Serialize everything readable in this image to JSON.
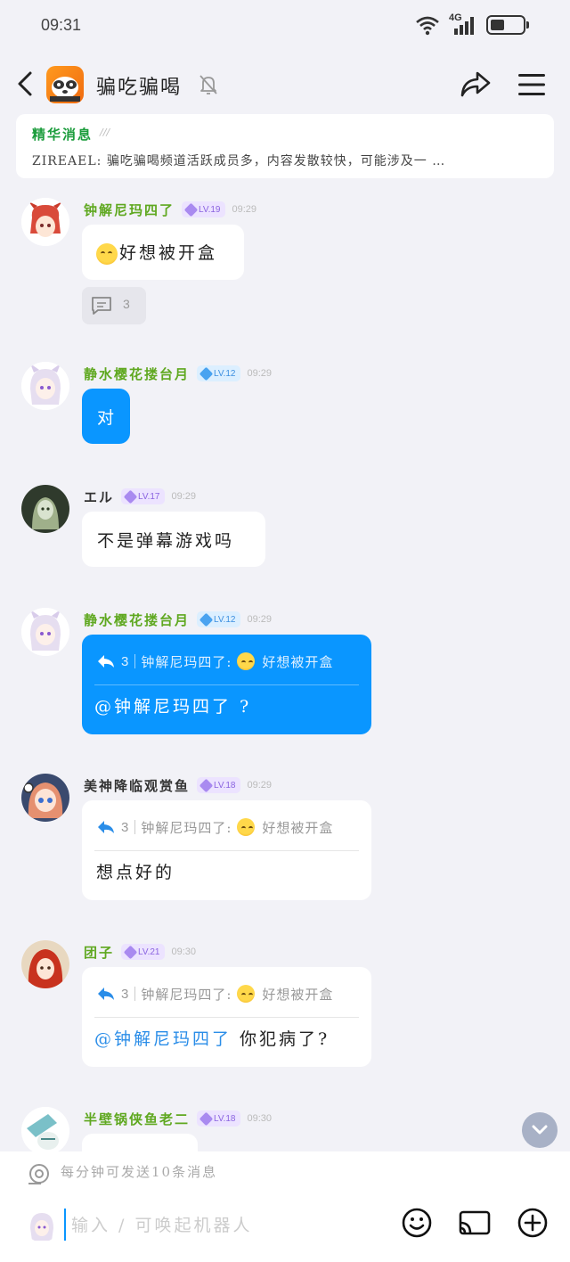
{
  "status_bar": {
    "time": "09:31",
    "network": "4G",
    "battery_level": 0.45
  },
  "header": {
    "title": "骗吃骗喝",
    "icons": [
      "back-icon",
      "channel-logo",
      "bell-off-icon",
      "share-icon",
      "menu-icon"
    ]
  },
  "pinned": {
    "title": "精华消息",
    "mark": "///",
    "text": "ZIREAEL: 骗吃骗喝频道活跃成员多，内容发散较快，可能涉及一 …"
  },
  "messages": [
    {
      "nick": "钟解尼玛四了",
      "level": "LV.19",
      "time": "09:29",
      "text": "好想被开盒",
      "thread_count": "3"
    },
    {
      "nick": "静水樱花搂台月",
      "level": "LV.12",
      "time": "09:29",
      "text": "对"
    },
    {
      "nick": "エル",
      "level": "LV.17",
      "time": "09:29",
      "text": "不是弹幕游戏吗"
    },
    {
      "nick": "静水樱花搂台月",
      "level": "LV.12",
      "time": "09:29",
      "quote_count": "3",
      "quote_text": "钟解尼玛四了:",
      "quote_msg": "好想被开盒",
      "mention": "@钟解尼玛四了",
      "text": " ?"
    },
    {
      "nick": "美神降临观赏鱼",
      "level": "LV.18",
      "time": "09:29",
      "quote_count": "3",
      "quote_text": "钟解尼玛四了:",
      "quote_msg": "好想被开盒",
      "text": "想点好的"
    },
    {
      "nick": "团子",
      "level": "LV.21",
      "time": "09:30",
      "quote_count": "3",
      "quote_text": "钟解尼玛四了:",
      "quote_msg": "好想被开盒",
      "mention": "@钟解尼玛四了",
      "text": " 你犯病了?"
    },
    {
      "nick": "半壁锅侠鱼老二",
      "level": "LV.18",
      "time": "09:30"
    }
  ],
  "composer": {
    "rate_limit": "每分钟可发送10条消息",
    "placeholder": "输入 / 可唤起机器人",
    "value": ""
  },
  "colors": {
    "accent": "#0a96ff",
    "nick_green": "#5fa820",
    "pinned_green": "#1b9c3c",
    "background": "#f2f2f7"
  }
}
